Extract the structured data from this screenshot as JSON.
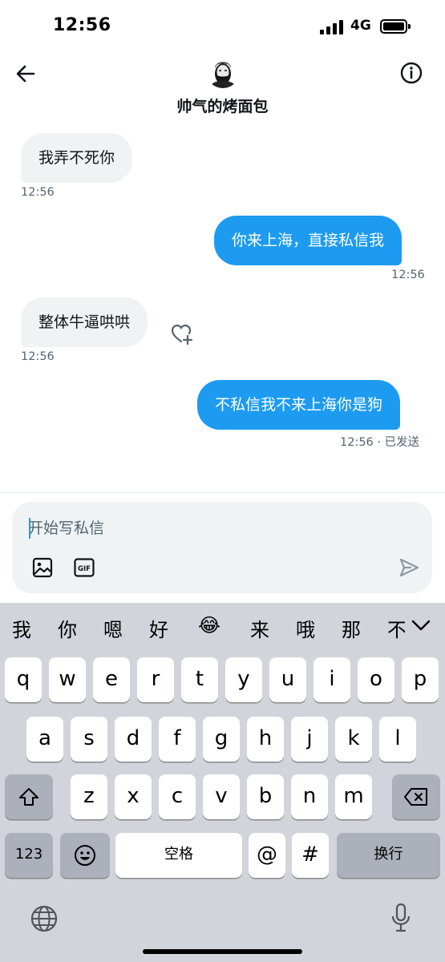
{
  "status_bar": {
    "time": "12:56",
    "network": "4G"
  },
  "header": {
    "contact_name": "帅气的烤面包"
  },
  "messages": [
    {
      "direction": "in",
      "text": "我弄不死你",
      "timestamp": "12:56"
    },
    {
      "direction": "out",
      "text": "你来上海，直接私信我",
      "timestamp": "12:56"
    },
    {
      "direction": "in",
      "text": "整体牛逼哄哄",
      "timestamp": "12:56"
    },
    {
      "direction": "out",
      "text": "不私信我不来上海你是狗",
      "timestamp": "12:56 · 已发送"
    }
  ],
  "composer": {
    "placeholder": "开始写私信",
    "gif_label": "GIF"
  },
  "keyboard": {
    "candidates": [
      "我",
      "你",
      "嗯",
      "好",
      "😂",
      "来",
      "哦",
      "那",
      "不"
    ],
    "row1": [
      "q",
      "w",
      "e",
      "r",
      "t",
      "y",
      "u",
      "i",
      "o",
      "p"
    ],
    "row2": [
      "a",
      "s",
      "d",
      "f",
      "g",
      "h",
      "j",
      "k",
      "l"
    ],
    "row3": [
      "z",
      "x",
      "c",
      "v",
      "b",
      "n",
      "m"
    ],
    "numbers_key": "123",
    "space_key": "空格",
    "at_key": "@",
    "hash_key": "#",
    "return_key": "换行"
  },
  "colors": {
    "accent": "#1d9bf0",
    "incoming_bubble": "#eff3f4",
    "keyboard_bg": "#d1d4da"
  }
}
